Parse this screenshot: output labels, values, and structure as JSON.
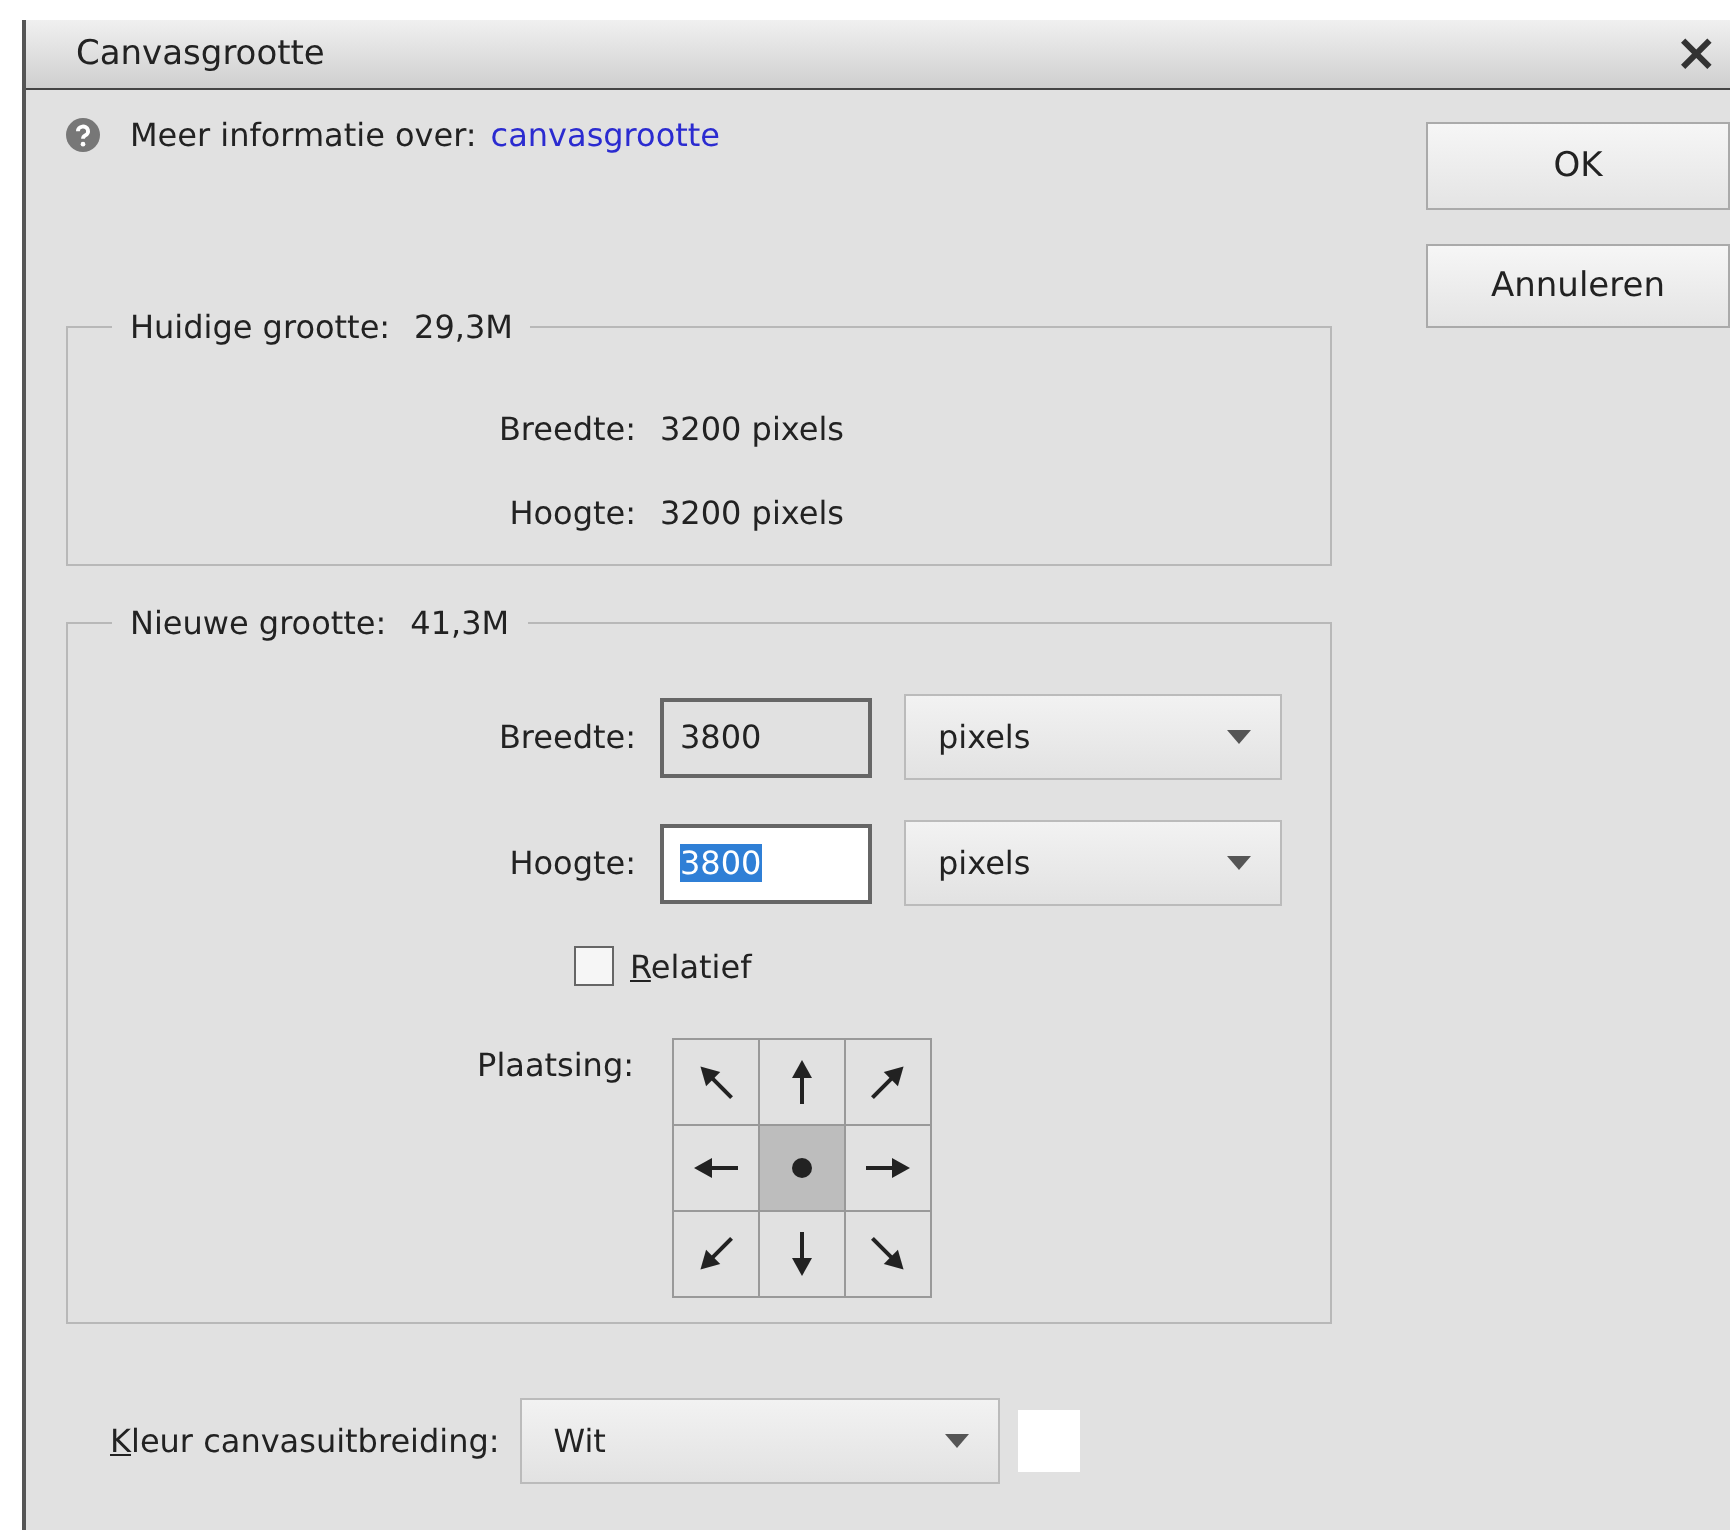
{
  "window": {
    "title": "Canvasgrootte",
    "close": "×"
  },
  "help": {
    "label": "Meer informatie over:",
    "link": "canvasgrootte"
  },
  "buttons": [
    "OK",
    "Annuleren"
  ],
  "current": {
    "legend": "Huidige grootte:",
    "size": "29,3M",
    "rows": [
      {
        "label": "Breedte:",
        "value": "3200 pixels"
      },
      {
        "label": "Hoogte:",
        "value": "3200 pixels"
      }
    ]
  },
  "new": {
    "legend": "Nieuwe grootte:",
    "size": "41,3M",
    "fields": [
      {
        "label": "Breedte:",
        "value": "3800",
        "selected": false,
        "unit": "pixels"
      },
      {
        "label": "Hoogte:",
        "value": "3800",
        "selected": true,
        "unit": "pixels"
      }
    ],
    "relative": {
      "label": "Relatief",
      "checked": false
    },
    "anchor": {
      "label": "Plaatsing:",
      "cells": [
        {
          "kind": "nw",
          "selected": false
        },
        {
          "kind": "n",
          "selected": false
        },
        {
          "kind": "ne",
          "selected": false
        },
        {
          "kind": "w",
          "selected": false
        },
        {
          "kind": "center",
          "selected": true
        },
        {
          "kind": "e",
          "selected": false
        },
        {
          "kind": "sw",
          "selected": false
        },
        {
          "kind": "s",
          "selected": false
        },
        {
          "kind": "se",
          "selected": false
        }
      ]
    }
  },
  "extension": {
    "label": "Kleur canvasuitbreiding:",
    "value": "Wit",
    "color": "#ffffff"
  }
}
